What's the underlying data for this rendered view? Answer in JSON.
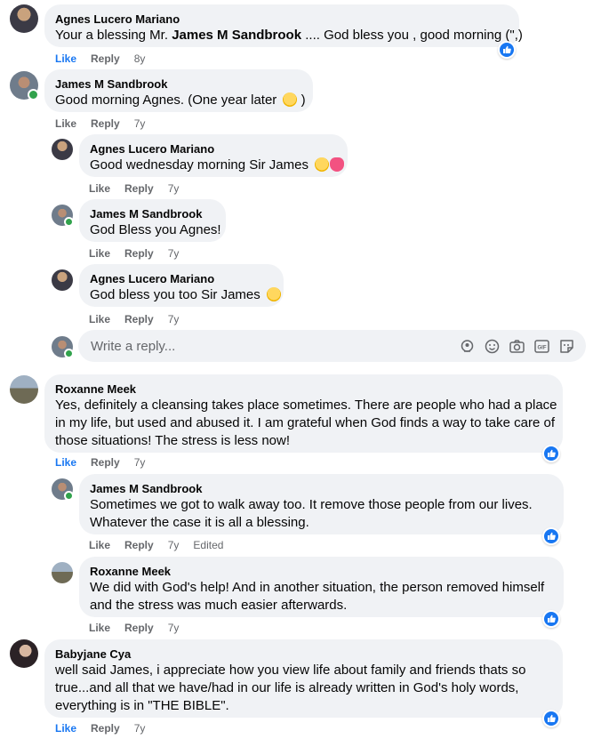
{
  "labels": {
    "like": "Like",
    "reply": "Reply"
  },
  "comments": [
    {
      "author": "Agnes Lucero Mariano",
      "text_pre": "Your a blessing Mr. ",
      "text_bold": "James M Sandbrook",
      "text_post": " .... God bless you , good morning (\",)",
      "time": "8y"
    },
    {
      "author": "James M Sandbrook",
      "text": "Good morning Agnes. (One year later",
      "text_post": " )",
      "time": "7y"
    },
    {
      "author": "Agnes Lucero Mariano",
      "text": "Good wednesday morning Sir James",
      "time": "7y"
    },
    {
      "author": "James M Sandbrook",
      "text": "God Bless you Agnes!",
      "time": "7y"
    },
    {
      "author": "Agnes Lucero Mariano",
      "text": "God bless you too Sir James",
      "time": "7y"
    },
    {
      "author": "Roxanne Meek",
      "lines": [
        "Yes, definitely a cleansing takes place sometimes. There are people who had a place",
        "in my life, but used and abused it. I am grateful when God finds a way to take care of",
        "those situations! The stress is less now!"
      ],
      "time": "7y"
    },
    {
      "author": "James M Sandbrook",
      "lines": [
        "Sometimes we got to walk away too. It remove those people from our lives.",
        "Whatever the case it is all a blessing."
      ],
      "time": "7y",
      "edited": "Edited"
    },
    {
      "author": "Roxanne Meek",
      "lines": [
        "We did with God's help! And in another situation, the person removed himself",
        "and the stress was much easier afterwards."
      ],
      "time": "7y"
    },
    {
      "author": "Babyjane Cya",
      "lines": [
        "well said James, i appreciate how you view life about family and friends thats so",
        "true...and all that we have/had in our life is already written in God's holy words,",
        "everything is in \"THE BIBLE\"."
      ],
      "time": "7y"
    }
  ],
  "reply_box": {
    "placeholder": "Write a reply..."
  },
  "colors": {
    "accent": "#1877f2",
    "bubble": "#f0f2f5",
    "meta": "#65676b",
    "online": "#31a24c"
  },
  "icons": [
    "avatar-sticker-icon",
    "emoji-icon",
    "camera-icon",
    "gif-icon",
    "sticker-icon"
  ]
}
